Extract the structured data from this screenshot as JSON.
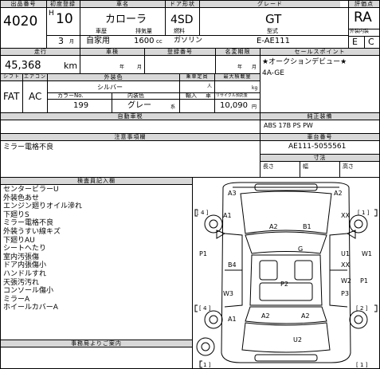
{
  "header": {
    "labels": {
      "lot_no": "出品番号",
      "first_reg": "初度登録",
      "car_name": "車名",
      "doors": "ドア形状",
      "grade": "グレード",
      "score": "評価点",
      "interior_exterior": "外装内装"
    },
    "lot_no": "4020",
    "era": "H",
    "year": "10",
    "month": "3",
    "month_unit": "月",
    "car_name": "カローラ",
    "doors": "4SD",
    "grade": "GT",
    "score": "RA",
    "usage_label": "車歴",
    "usage": "自家用",
    "displacement_label": "排気量",
    "displacement": "1600",
    "displacement_unit": "cc",
    "fuel_label": "燃料",
    "fuel": "ガソリン",
    "model_label": "型式",
    "model": "E-AE111",
    "exterior_score": "E",
    "interior_score": "C"
  },
  "row2": {
    "mileage_label": "走行",
    "mileage": "45,368",
    "mileage_unit": "km",
    "inspection_label": "車検",
    "inspection_year": "年",
    "inspection_month": "月",
    "registration_label": "登録番号",
    "name_change_label": "名変期限",
    "name_change_year": "年",
    "name_change_month": "月",
    "sales_point_label": "セールスポイント",
    "sales_points": [
      "★オークションデビュー★",
      "4A-GE"
    ]
  },
  "specs": {
    "shift_label": "シフト",
    "ac_label": "エアコン",
    "shift": "FAT",
    "ac": "AC",
    "exterior_color_label": "外装色",
    "exterior_color": "シルバー",
    "color_no_label": "カラーNo.",
    "color_no": "199",
    "interior_color_label": "内装色",
    "interior_color": "グレー",
    "interior_color_unit": "系",
    "capacity_label": "乗車定員",
    "capacity_unit": "人",
    "payload_label": "最大積載量",
    "payload_unit": "kg",
    "import_label": "輸入",
    "import_value": "車",
    "recycle_label": "リサイクル預託金",
    "recycle": "10,090",
    "recycle_unit": "円",
    "shipping_label": "自動車税",
    "genuine_equipment_label": "純正装備",
    "genuine_equipment": "ABS 17B PS PW"
  },
  "notes": {
    "caution_label": "注意事項欄",
    "caution": "ミラー電格不良",
    "frame_no_label": "車台番号",
    "frame_no": "AE111-5055561",
    "dimensions_label": "寸法",
    "length_label": "長さ",
    "width_label": "幅",
    "height_label": "高さ"
  },
  "inspection": {
    "label": "検査員記入欄",
    "items": [
      "センタービラーU",
      "外装色あせ",
      "エンジン廻りオイル滲れ",
      "下廻りS",
      "ミラー電格不良",
      "外装うすい線キズ",
      "下廻りAU",
      "シートへたり",
      "室内汚張傷",
      "ドア内張傷小",
      "ハンドルすれ",
      "天張汚汚れ",
      "コンソール傷小",
      "ミラーA",
      "ホイールカバーA"
    ]
  },
  "office": {
    "label": "事務局よりご案内"
  },
  "diagram": {
    "marks": [
      "A3",
      "A2",
      "4",
      "1",
      "A1",
      "XX",
      "A2",
      "B1",
      "P1",
      "G",
      "U1",
      "W1",
      "B4",
      "XX",
      "P2",
      "W2",
      "P1",
      "W3",
      "P3",
      "A1",
      "A2",
      "A2",
      "U2",
      "4",
      "2",
      "1",
      "1",
      "1"
    ]
  }
}
